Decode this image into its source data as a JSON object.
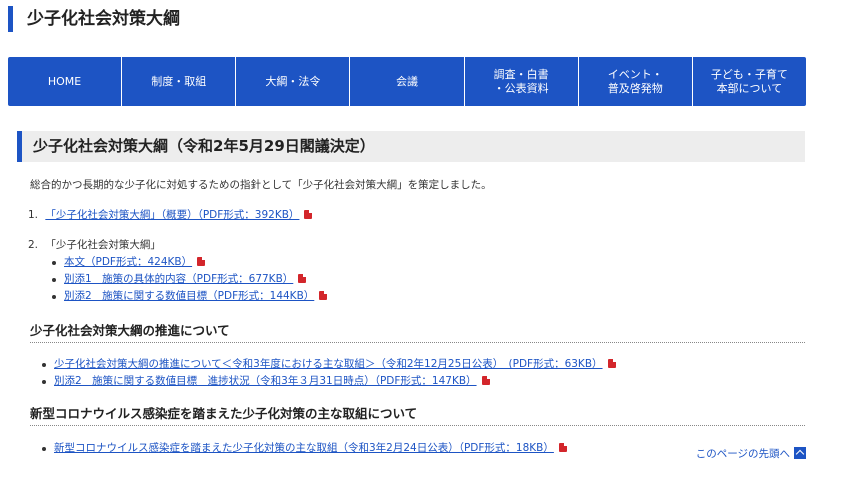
{
  "page_title": "少子化社会対策大綱",
  "nav": [
    {
      "label": "HOME"
    },
    {
      "label": "制度・取組"
    },
    {
      "label": "大綱・法令"
    },
    {
      "label": "会議"
    },
    {
      "label": "調査・白書\n・公表資料"
    },
    {
      "label": "イベント・\n普及啓発物"
    },
    {
      "label": "子ども・子育て\n本部について"
    }
  ],
  "section_title": "少子化社会対策大綱（令和2年5月29日閣議決定）",
  "intro": "総合的かつ長期的な少子化に対処するための指針として「少子化社会対策大綱」を策定しました。",
  "list": [
    {
      "num": "1.",
      "link": "「少子化社会対策大綱」（概要）（PDF形式：392KB）"
    },
    {
      "num": "2.",
      "text": "「少子化社会対策大綱」",
      "sub_links": [
        "本文（PDF形式：424KB）",
        "別添1　施策の具体的内容（PDF形式：677KB）",
        "別添2　施策に関する数値目標（PDF形式：144KB）"
      ]
    }
  ],
  "promotion": {
    "heading": "少子化社会対策大綱の推進について",
    "links": [
      "少子化社会対策大綱の推進について＜令和3年度における主な取組＞（令和2年12月25日公表）　(PDF形式：63KB）",
      "別添2　施策に関する数値目標　進捗状況（令和3年３月31日時点）（PDF形式：147KB）"
    ]
  },
  "covid": {
    "heading": "新型コロナウイルス感染症を踏まえた少子化対策の主な取組について",
    "links": [
      "新型コロナウイルス感染症を踏まえた少子化対策の主な取組（令和3年2月24日公表）（PDF形式：18KB）"
    ]
  },
  "page_top": "このページの先頭へ",
  "icons": {
    "pdf": "pdf-icon",
    "up": "chevron-up-icon"
  },
  "colors": {
    "accent": "#1d54c4",
    "pdf": "#d3262b",
    "section_bg": "#ededed"
  }
}
